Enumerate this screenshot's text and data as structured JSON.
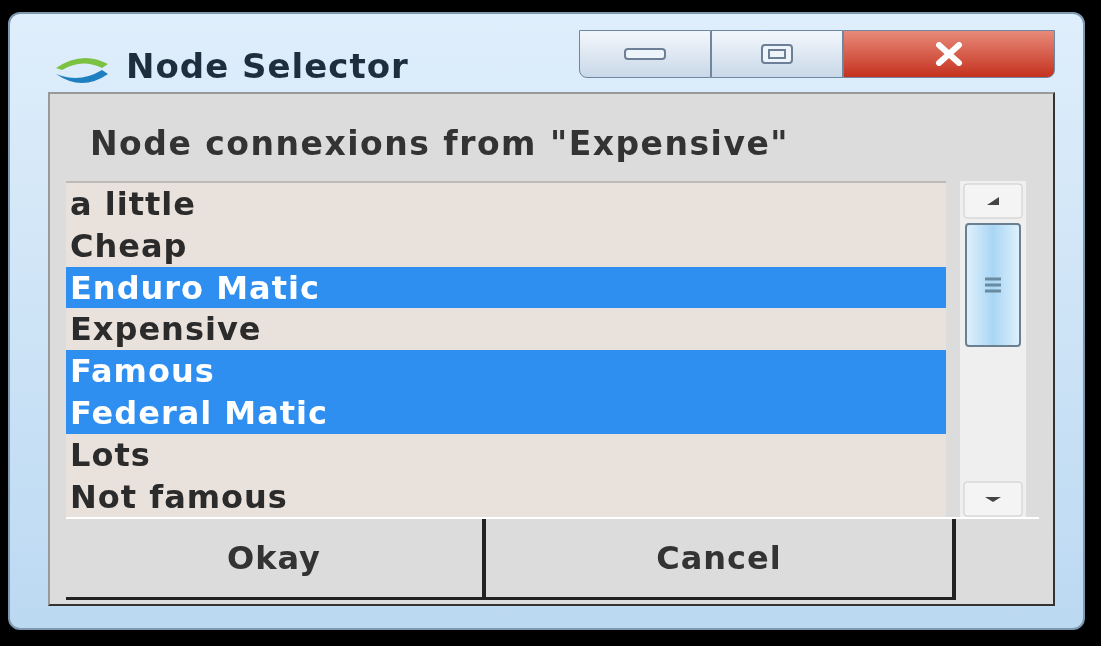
{
  "window": {
    "title": "Node Selector"
  },
  "heading": "Node connexions from \"Expensive\"",
  "items": [
    {
      "label": "a little",
      "selected": false
    },
    {
      "label": "Cheap",
      "selected": false
    },
    {
      "label": "Enduro Matic",
      "selected": true
    },
    {
      "label": "Expensive",
      "selected": false
    },
    {
      "label": "Famous",
      "selected": true
    },
    {
      "label": "Federal Matic",
      "selected": true
    },
    {
      "label": "Lots",
      "selected": false
    },
    {
      "label": "Not famous",
      "selected": false
    }
  ],
  "buttons": [
    "Okay",
    "Cancel"
  ]
}
